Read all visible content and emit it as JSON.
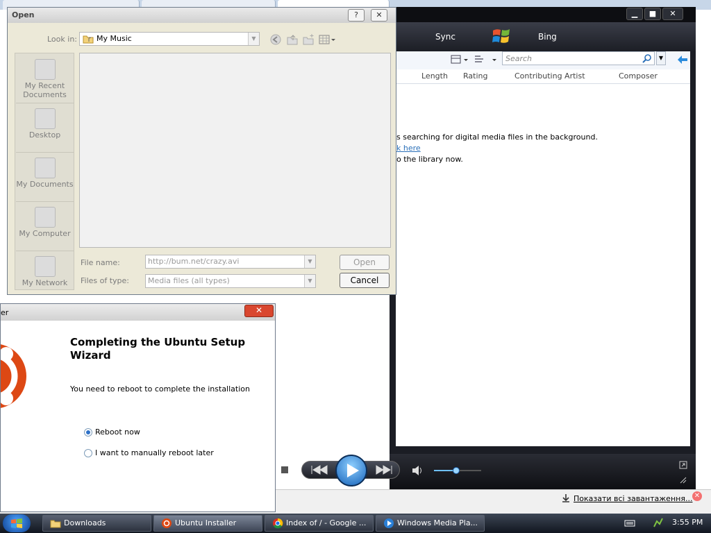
{
  "download_bar": {
    "show_all_label": "Показати всі завантаження..."
  },
  "wmp": {
    "nav": {
      "sync": "Sync",
      "bing": "Bing"
    },
    "search_placeholder": "Search",
    "columns": [
      "Length",
      "Rating",
      "Contributing Artist",
      "Composer"
    ],
    "messages": {
      "line1": "s searching for digital media files in the background.",
      "line2": "k here",
      "line3": "o the library now."
    }
  },
  "open_dialog": {
    "title": "Open",
    "help_btn": "?",
    "close_btn": "✕",
    "look_in_label": "Look in:",
    "look_in_value": "My Music",
    "places": [
      "My Recent Documents",
      "Desktop",
      "My Documents",
      "My Computer",
      "My Network"
    ],
    "file_name_label": "File name:",
    "file_name_value": "http://bum.net/crazy.avi",
    "files_of_type_label": "Files of type:",
    "files_of_type_value": "Media files (all types)",
    "open_button": "Open",
    "cancel_button": "Cancel"
  },
  "ubuntu_wizard": {
    "title_fragment": "er",
    "heading": "Completing the Ubuntu Setup Wizard",
    "subtext": "You need to reboot to complete the installation",
    "option_reboot_now": "Reboot now",
    "option_reboot_later": "I want to manually reboot later",
    "close_glyph": "✕"
  },
  "taskbar": {
    "tasks": [
      "Downloads",
      "Ubuntu Installer",
      "Index of / - Google ...",
      "Windows Media Pla..."
    ],
    "clock": "3:55 PM"
  },
  "colors": {
    "ubuntu_orange": "#dd4814",
    "wmp_dark": "#1b1d24",
    "taskbar": "#1e2530"
  }
}
